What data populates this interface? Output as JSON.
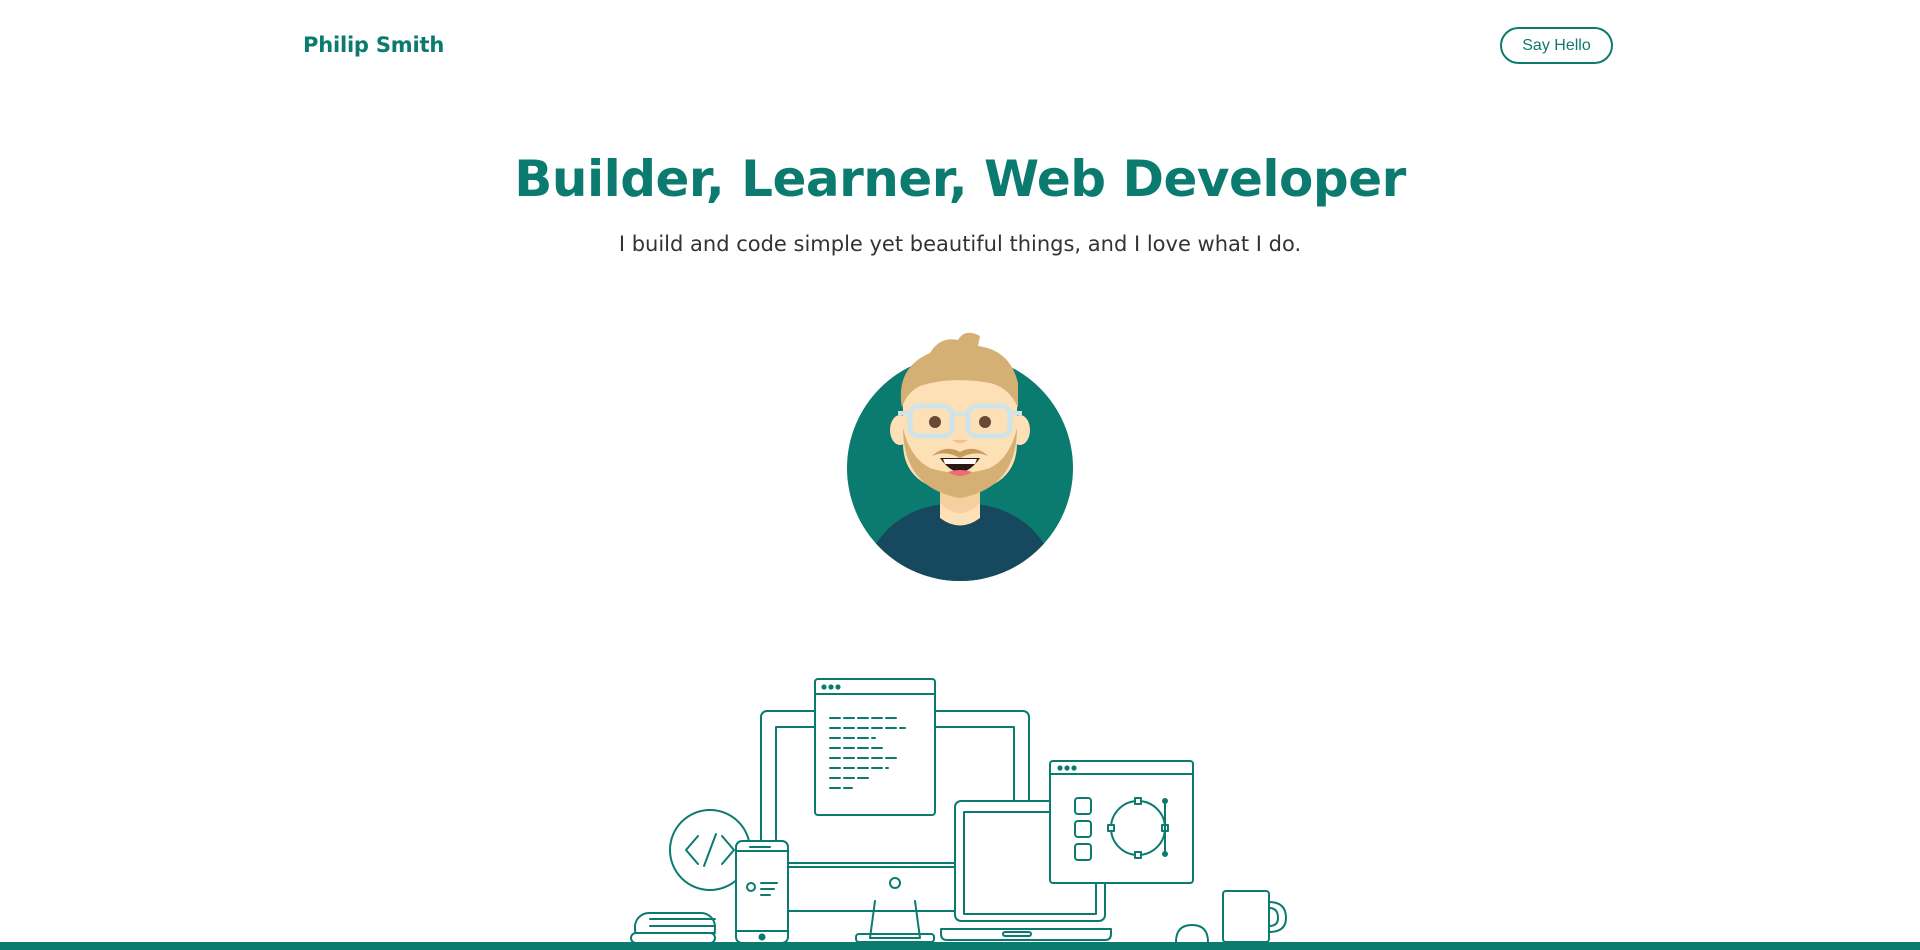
{
  "header": {
    "brand": "Philip Smith",
    "cta_label": "Say Hello"
  },
  "hero": {
    "title": "Builder, Learner, Web Developer",
    "subtitle": "I build and code simple yet beautiful things, and I love what I do."
  },
  "colors": {
    "accent": "#0b7a6f",
    "text": "#333333",
    "shirt": "#16485e",
    "hair": "#d4b075",
    "skin": "#fde0b6"
  },
  "icons": [
    "avatar-illustration",
    "devices-illustration",
    "code-icon"
  ]
}
